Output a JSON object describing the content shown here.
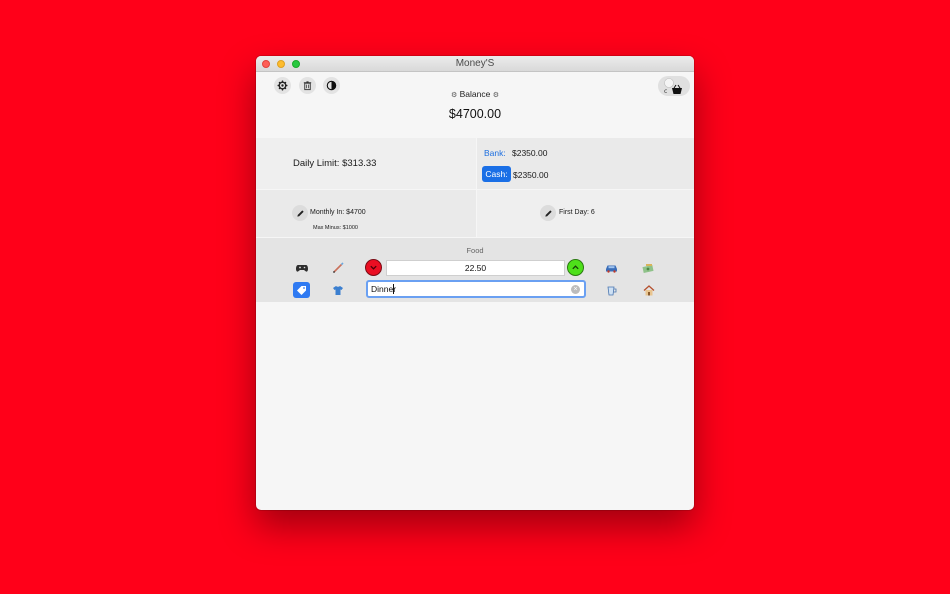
{
  "window": {
    "title": "Money'S"
  },
  "toolbar": {
    "settings_icon": "gear-icon",
    "delete_icon": "trash-icon",
    "theme_icon": "contrast-icon",
    "cart_icon": "cart-icon"
  },
  "balance": {
    "label": "Balance",
    "value": "$4700.00"
  },
  "daily_limit": {
    "text": "Daily Limit: $313.33"
  },
  "accounts": {
    "bank_label": "Bank:",
    "bank_value": "$2350.00",
    "cash_label": "Cash:",
    "cash_value": "$2350.00"
  },
  "monthly": {
    "label": "Monthly In: $4700",
    "max_minus": "Max Minus: $1000"
  },
  "first_day": {
    "label": "First Day: 6"
  },
  "entry": {
    "category_label": "Food",
    "amount": "22.50",
    "description": "Dinner"
  },
  "categories": {
    "row1": [
      "gamepad-icon",
      "pencil-brush-icon",
      "car-icon",
      "money-icon"
    ],
    "row2": [
      "tag-icon",
      "shirt-icon",
      "cup-icon",
      "house-icon"
    ],
    "selected": "tag-icon"
  },
  "colors": {
    "background": "#ff0019",
    "accent": "#1a6fe6",
    "minus": "#ea0e22",
    "plus": "#4ee01a"
  }
}
